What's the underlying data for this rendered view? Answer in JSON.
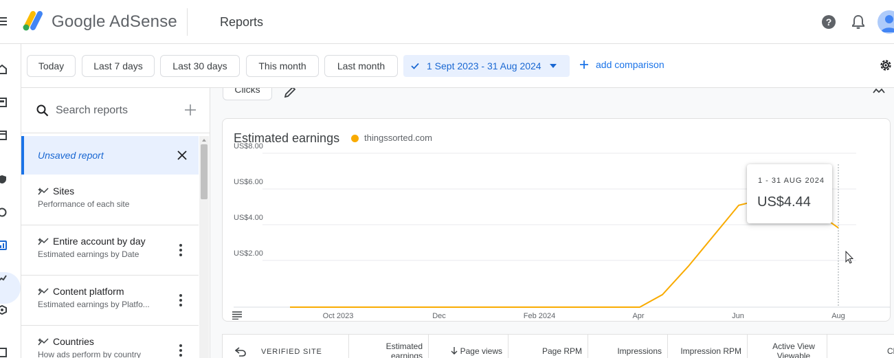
{
  "header": {
    "brand": "Google AdSense",
    "page_title": "Reports"
  },
  "filters": {
    "chips": [
      "Today",
      "Last 7 days",
      "Last 30 days",
      "This month",
      "Last month"
    ],
    "date_range": "1 Sept 2023 - 31 Aug 2024",
    "add_comparison": "add comparison"
  },
  "sidebar": {
    "search_placeholder": "Search reports",
    "unsaved_label": "Unsaved report",
    "items": [
      {
        "title": "Sites",
        "subtitle": "Performance of each site"
      },
      {
        "title": "Entire account by day",
        "subtitle": "Estimated earnings by Date"
      },
      {
        "title": "Content platform",
        "subtitle": "Estimated earnings by Platfo..."
      },
      {
        "title": "Countries",
        "subtitle": "How ads perform by country"
      }
    ]
  },
  "main": {
    "metric_chip": "Clicks"
  },
  "chart_data": {
    "type": "line",
    "title": "Estimated earnings",
    "series": [
      {
        "name": "thingssorted.com",
        "color": "#f9ab00",
        "values": [
          0,
          0,
          0,
          0,
          0,
          0,
          0,
          0,
          0.7,
          2.3,
          5.7,
          6.4,
          4.44
        ]
      }
    ],
    "x": [
      "Sept 2023",
      "Oct 2023",
      "Nov 2023",
      "Dec 2023",
      "Jan 2024",
      "Feb 2024",
      "Mar 2024",
      "Apr 2024",
      "Apr 2024b",
      "May 2024",
      "Jun 2024",
      "Jul 2024",
      "Aug 2024"
    ],
    "y_ticks": [
      "US$2.00",
      "US$4.00",
      "US$6.00",
      "US$8.00"
    ],
    "x_ticks": [
      "Oct 2023",
      "Dec",
      "Feb 2024",
      "Apr",
      "Jun",
      "Aug"
    ],
    "ylim": [
      0,
      8
    ],
    "grid": true
  },
  "tooltip": {
    "date": "1 - 31 AUG 2024",
    "value": "US$4.44"
  },
  "table": {
    "site_header": "VERIFIED SITE",
    "columns": [
      "Estimated earnings",
      "Page views",
      "Page RPM",
      "Impressions",
      "Impression RPM",
      "Active View Viewable",
      "Clicks"
    ]
  }
}
